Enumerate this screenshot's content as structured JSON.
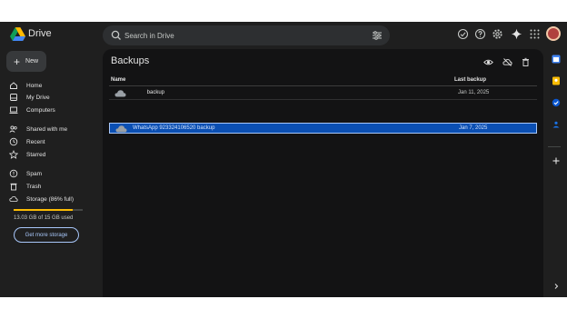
{
  "header": {
    "brand": "Drive",
    "search_placeholder": "Search in Drive"
  },
  "sidebar": {
    "new_label": "New",
    "items": [
      {
        "label": "Home",
        "icon": "home-icon"
      },
      {
        "label": "My Drive",
        "icon": "my-drive-icon"
      },
      {
        "label": "Computers",
        "icon": "computers-icon"
      },
      {
        "label": "Shared with me",
        "icon": "shared-icon"
      },
      {
        "label": "Recent",
        "icon": "clock-icon"
      },
      {
        "label": "Starred",
        "icon": "star-icon"
      },
      {
        "label": "Spam",
        "icon": "spam-icon"
      },
      {
        "label": "Trash",
        "icon": "trash-icon"
      },
      {
        "label": "Storage (86% full)",
        "icon": "cloud-icon"
      }
    ],
    "storage_used_fraction": 0.86,
    "storage_text": "13.03 GB of 15 GB used",
    "get_storage_label": "Get more storage"
  },
  "main": {
    "title": "Backups",
    "columns": {
      "name": "Name",
      "last_backup": "Last backup"
    },
    "rows": [
      {
        "name": "          backup",
        "date": "Jan 11, 2025",
        "selected": false
      },
      {
        "name": "WhatsApp 923324106520 backup",
        "date": "Jan 7, 2025",
        "selected": true
      }
    ]
  },
  "colors": {
    "background": "#1f1f1f",
    "panel": "#131314",
    "selection": "#0b4fb3",
    "accent": "#a8c7fa",
    "storage_bar": "#fbbc04"
  }
}
